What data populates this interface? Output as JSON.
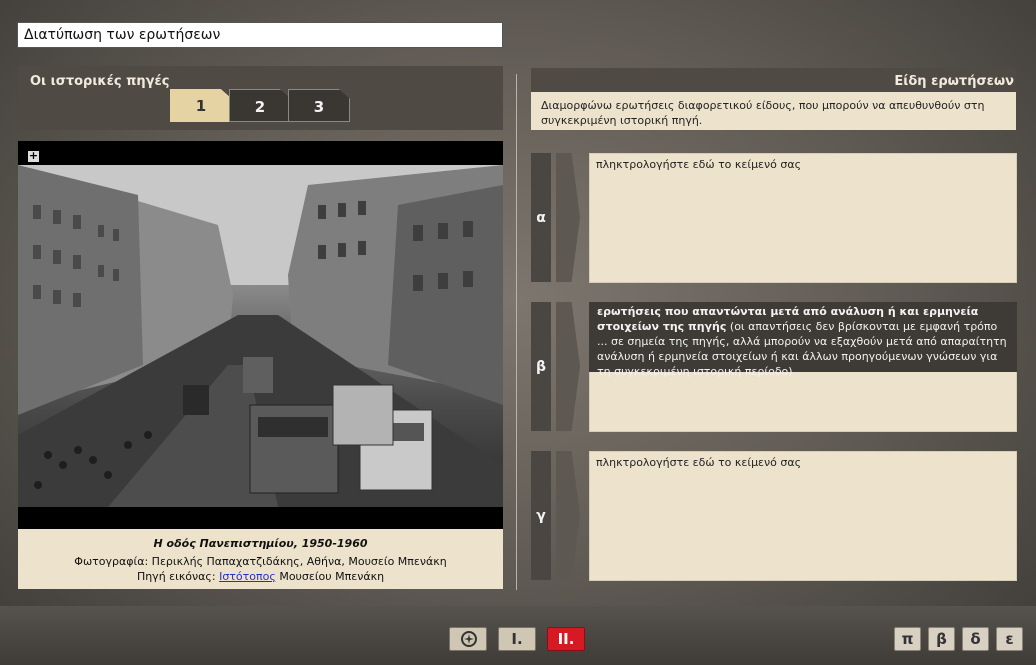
{
  "page": {
    "title": "Διατύπωση των ερωτήσεων"
  },
  "sources": {
    "title": "Οι ιστορικές πηγές",
    "tabs": [
      {
        "label": "1"
      },
      {
        "label": "2"
      },
      {
        "label": "3"
      }
    ],
    "active_tab": 0,
    "zoom_in": "+",
    "zoom_out": "−",
    "caption": {
      "title": "Η οδός Πανεπιστημίου, 1950-1960",
      "credit": "Φωτογραφία: Περικλής Παπαχατζιδάκης, Αθήνα, Μουσείο Μπενάκη",
      "source_prefix": "Πηγή εικόνας: ",
      "source_link": "Ιστότοπος",
      "source_suffix": " Μουσείου Μπενάκη"
    }
  },
  "question_types": {
    "title": "Είδη ερωτήσεων",
    "description": "Διαμορφώνω ερωτήσεις διαφορετικού είδους, που μπορούν να απευθυνθούν στη συγκεκριμένη ιστορική πηγή.",
    "items": [
      {
        "label": "α",
        "placeholder": "πληκτρολογήστε εδώ το κείμενό σας"
      },
      {
        "label": "β",
        "hint_bold": "ερωτήσεις που απαντώνται μετά από ανάλυση ή και ερμηνεία στοιχείων της πηγής",
        "hint_rest": " (οι απαντήσεις δεν βρίσκονται με εμφανή τρόπο ... σε σημεία της πηγής, αλλά μπορούν να εξαχθούν μετά από απαραίτητη ανάλυση ή ερμηνεία στοιχείων ή και άλλων προηγούμενων γνώσεων για τη συγκεκριμένη ιστορική περίοδο)"
      },
      {
        "label": "γ",
        "placeholder": "πληκτρολογήστε εδώ το κείμενό σας"
      }
    ]
  },
  "nav": {
    "home_icon": "compass-icon",
    "sections": [
      {
        "label": "I."
      },
      {
        "label": "II."
      }
    ],
    "active_section": 1,
    "right": [
      {
        "label": "π"
      },
      {
        "label": "β"
      },
      {
        "label": "δ"
      },
      {
        "label": "ε"
      }
    ],
    "active_color": "#d51a23"
  }
}
